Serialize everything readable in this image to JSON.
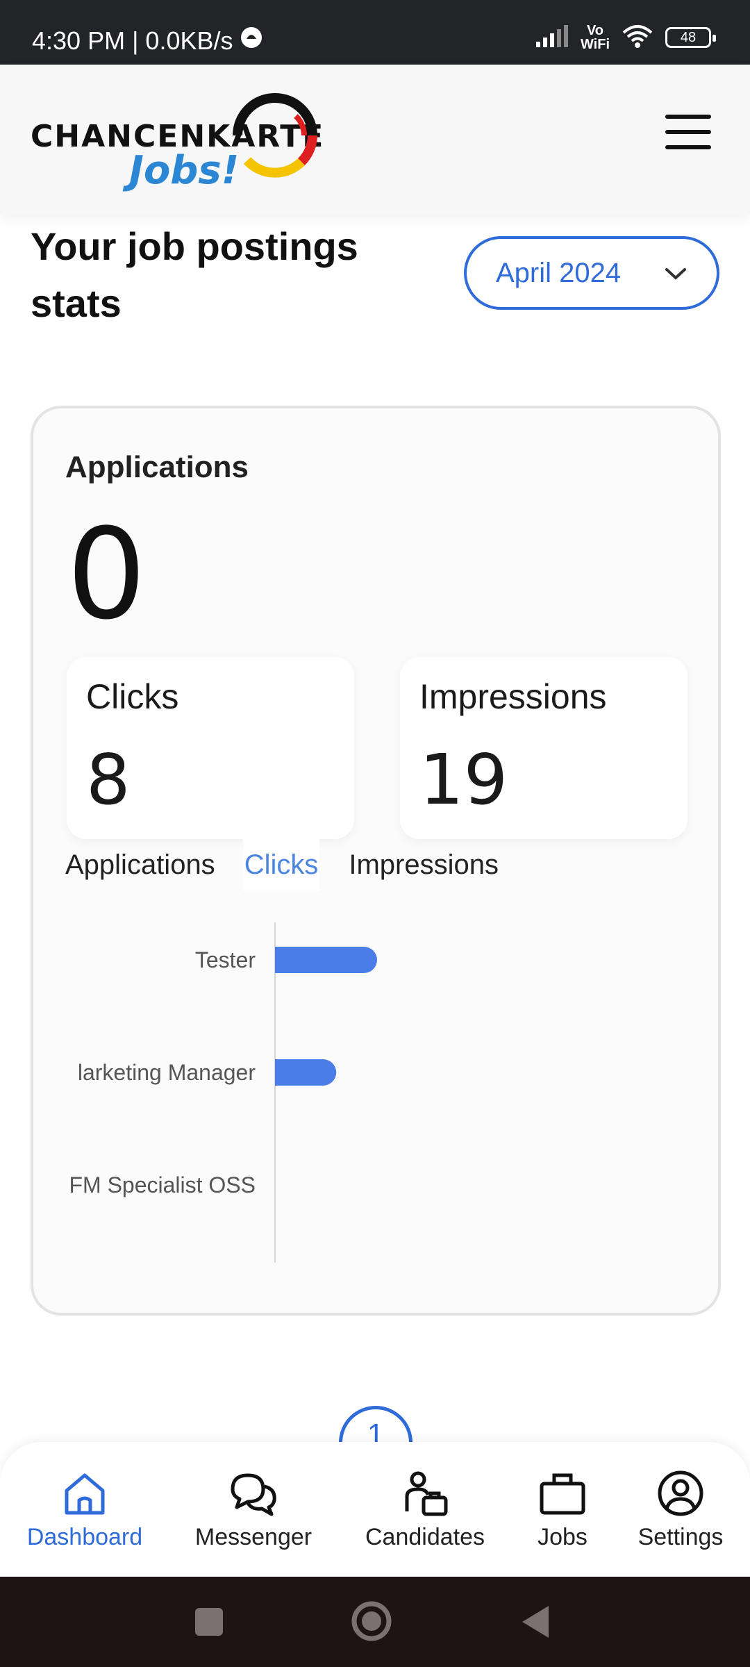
{
  "status_bar": {
    "time_net": "4:30 PM | 0.0KB/s",
    "vowifi_top": "Vo",
    "vowifi_bottom": "WiFi",
    "battery": "48"
  },
  "header": {
    "logo_brand": "CHANCENKARTE",
    "logo_sub": "Jobs!"
  },
  "page": {
    "title": "Your job postings stats",
    "month_select": "April 2024"
  },
  "stats": {
    "applications_label": "Applications",
    "applications_value": "0",
    "clicks_label": "Clicks",
    "clicks_value": "8",
    "impressions_label": "Impressions",
    "impressions_value": "19"
  },
  "tabs": [
    "Applications",
    "Clicks",
    "Impressions"
  ],
  "active_tab": "Clicks",
  "chart_data": {
    "type": "bar",
    "orientation": "horizontal",
    "categories": [
      "Tester",
      "Marketing Manager",
      "FM Specialist OSS"
    ],
    "category_labels_shown": [
      "Tester",
      "larketing Manager",
      "FM Specialist OSS"
    ],
    "values": [
      5,
      3,
      0
    ],
    "xlim": [
      0,
      10
    ],
    "bar_color": "#4a7de8",
    "grid": false
  },
  "pagination": {
    "current_page": "1"
  },
  "bottom_nav": {
    "items": [
      {
        "label": "Dashboard",
        "icon": "home-icon",
        "active": true
      },
      {
        "label": "Messenger",
        "icon": "chat-icon",
        "active": false
      },
      {
        "label": "Candidates",
        "icon": "candidate-icon",
        "active": false
      },
      {
        "label": "Jobs",
        "icon": "briefcase-icon",
        "active": false
      },
      {
        "label": "Settings",
        "icon": "user-circle-icon",
        "active": false
      }
    ]
  },
  "colors": {
    "accent": "#2f6bd9",
    "status_bar": "#222427",
    "system_nav": "#1d1414"
  }
}
